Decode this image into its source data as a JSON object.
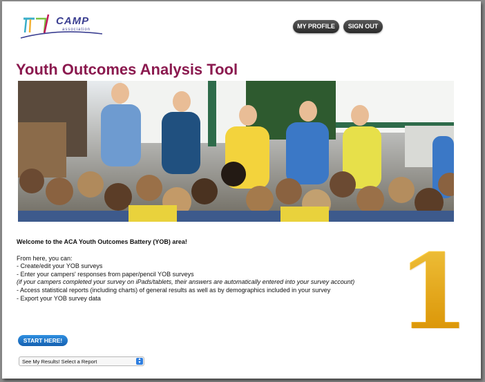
{
  "header": {
    "logo": {
      "text": "CAMP",
      "subtext": "association",
      "icon": "aca-logo-icon"
    },
    "my_profile_label": "MY PROFILE",
    "sign_out_label": "SIGN OUT"
  },
  "page": {
    "title": "Youth Outcomes Analysis Tool",
    "hero_image": "camp-counselors-and-campers-photo"
  },
  "intro": {
    "welcome": "Welcome to the ACA Youth Outcomes Battery (YOB) area!",
    "lead": "From here, you can:",
    "items": [
      " - Create/edit your YOB surveys",
      " - Enter your campers' responses from paper/pencil YOB surveys",
      "(if your campers completed your survey on iPads/tablets, their answers are automatically entered into your survey account)",
      " - Access statistical reports (including charts) of general results as well as by demographics included in your survey",
      " - Export your YOB survey data"
    ]
  },
  "actions": {
    "start_label": "START HERE!",
    "report_select": {
      "selected": "See My Results! Select a Report"
    }
  },
  "annotation": {
    "step_number": "1"
  },
  "colors": {
    "title": "#8b1a4f",
    "start_button": "#1f74c9",
    "annotation": "#f3b800"
  }
}
